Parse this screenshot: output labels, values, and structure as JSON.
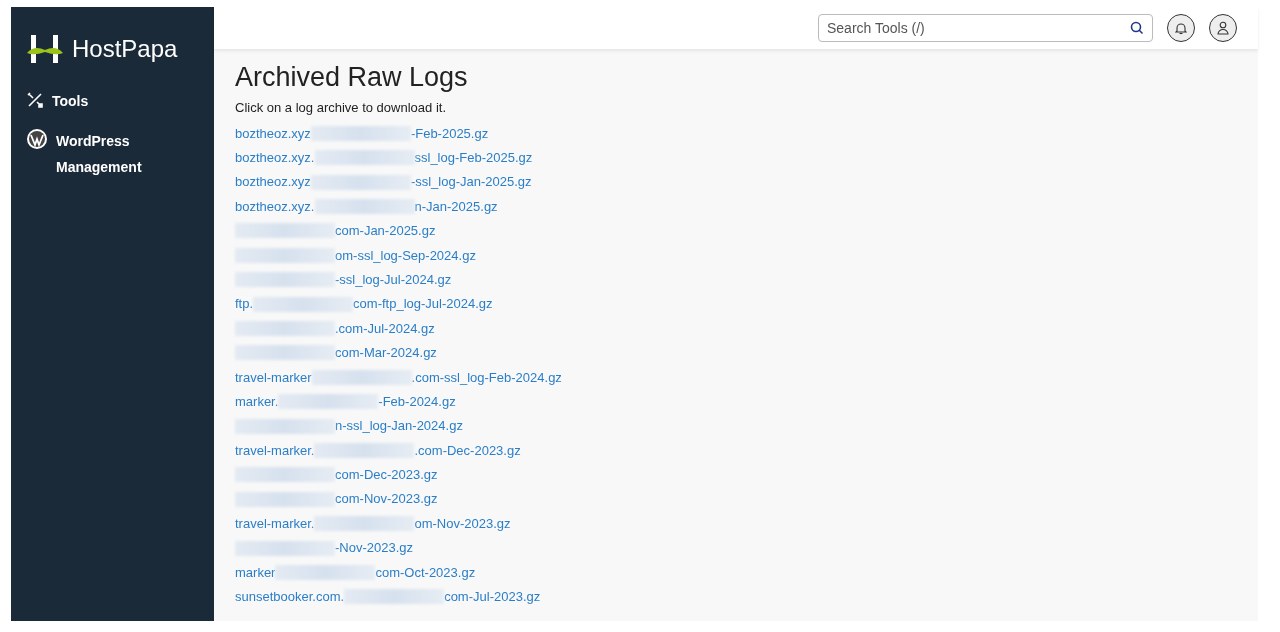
{
  "sidebar": {
    "brand": "HostPapa",
    "items": [
      {
        "kind": "tools",
        "label": "Tools"
      },
      {
        "kind": "wordpress",
        "label": "WordPress Management"
      }
    ]
  },
  "header": {
    "search": {
      "placeholder": "Search Tools (/)"
    }
  },
  "page": {
    "title": "Archived Raw Logs",
    "intro": "Click on a log archive to download it.",
    "logs": [
      {
        "before": "boztheoz.xyz",
        "after": "-Feb-2025.gz"
      },
      {
        "before": "boztheoz.xyz.",
        "after": "ssl_log-Feb-2025.gz"
      },
      {
        "before": "boztheoz.xyz",
        "after": "-ssl_log-Jan-2025.gz"
      },
      {
        "before": "boztheoz.xyz.",
        "after": "n-Jan-2025.gz"
      },
      {
        "after": "com-Jan-2025.gz"
      },
      {
        "after": "om-ssl_log-Sep-2024.gz"
      },
      {
        "after": "-ssl_log-Jul-2024.gz"
      },
      {
        "before": "ftp.",
        "after": "com-ftp_log-Jul-2024.gz"
      },
      {
        "after": ".com-Jul-2024.gz"
      },
      {
        "after": "com-Mar-2024.gz"
      },
      {
        "before": "travel-marker",
        "after": ".com-ssl_log-Feb-2024.gz"
      },
      {
        "before": "marker.",
        "after": "-Feb-2024.gz"
      },
      {
        "after": "n-ssl_log-Jan-2024.gz"
      },
      {
        "before": "travel-marker.",
        "after": ".com-Dec-2023.gz"
      },
      {
        "after": "com-Dec-2023.gz"
      },
      {
        "after": "com-Nov-2023.gz"
      },
      {
        "before": "travel-marker.",
        "after": "om-Nov-2023.gz"
      },
      {
        "after": "-Nov-2023.gz"
      },
      {
        "before": "marker",
        "after": "com-Oct-2023.gz"
      },
      {
        "before": "sunsetbooker.com.",
        "after": "com-Jul-2023.gz"
      }
    ]
  }
}
